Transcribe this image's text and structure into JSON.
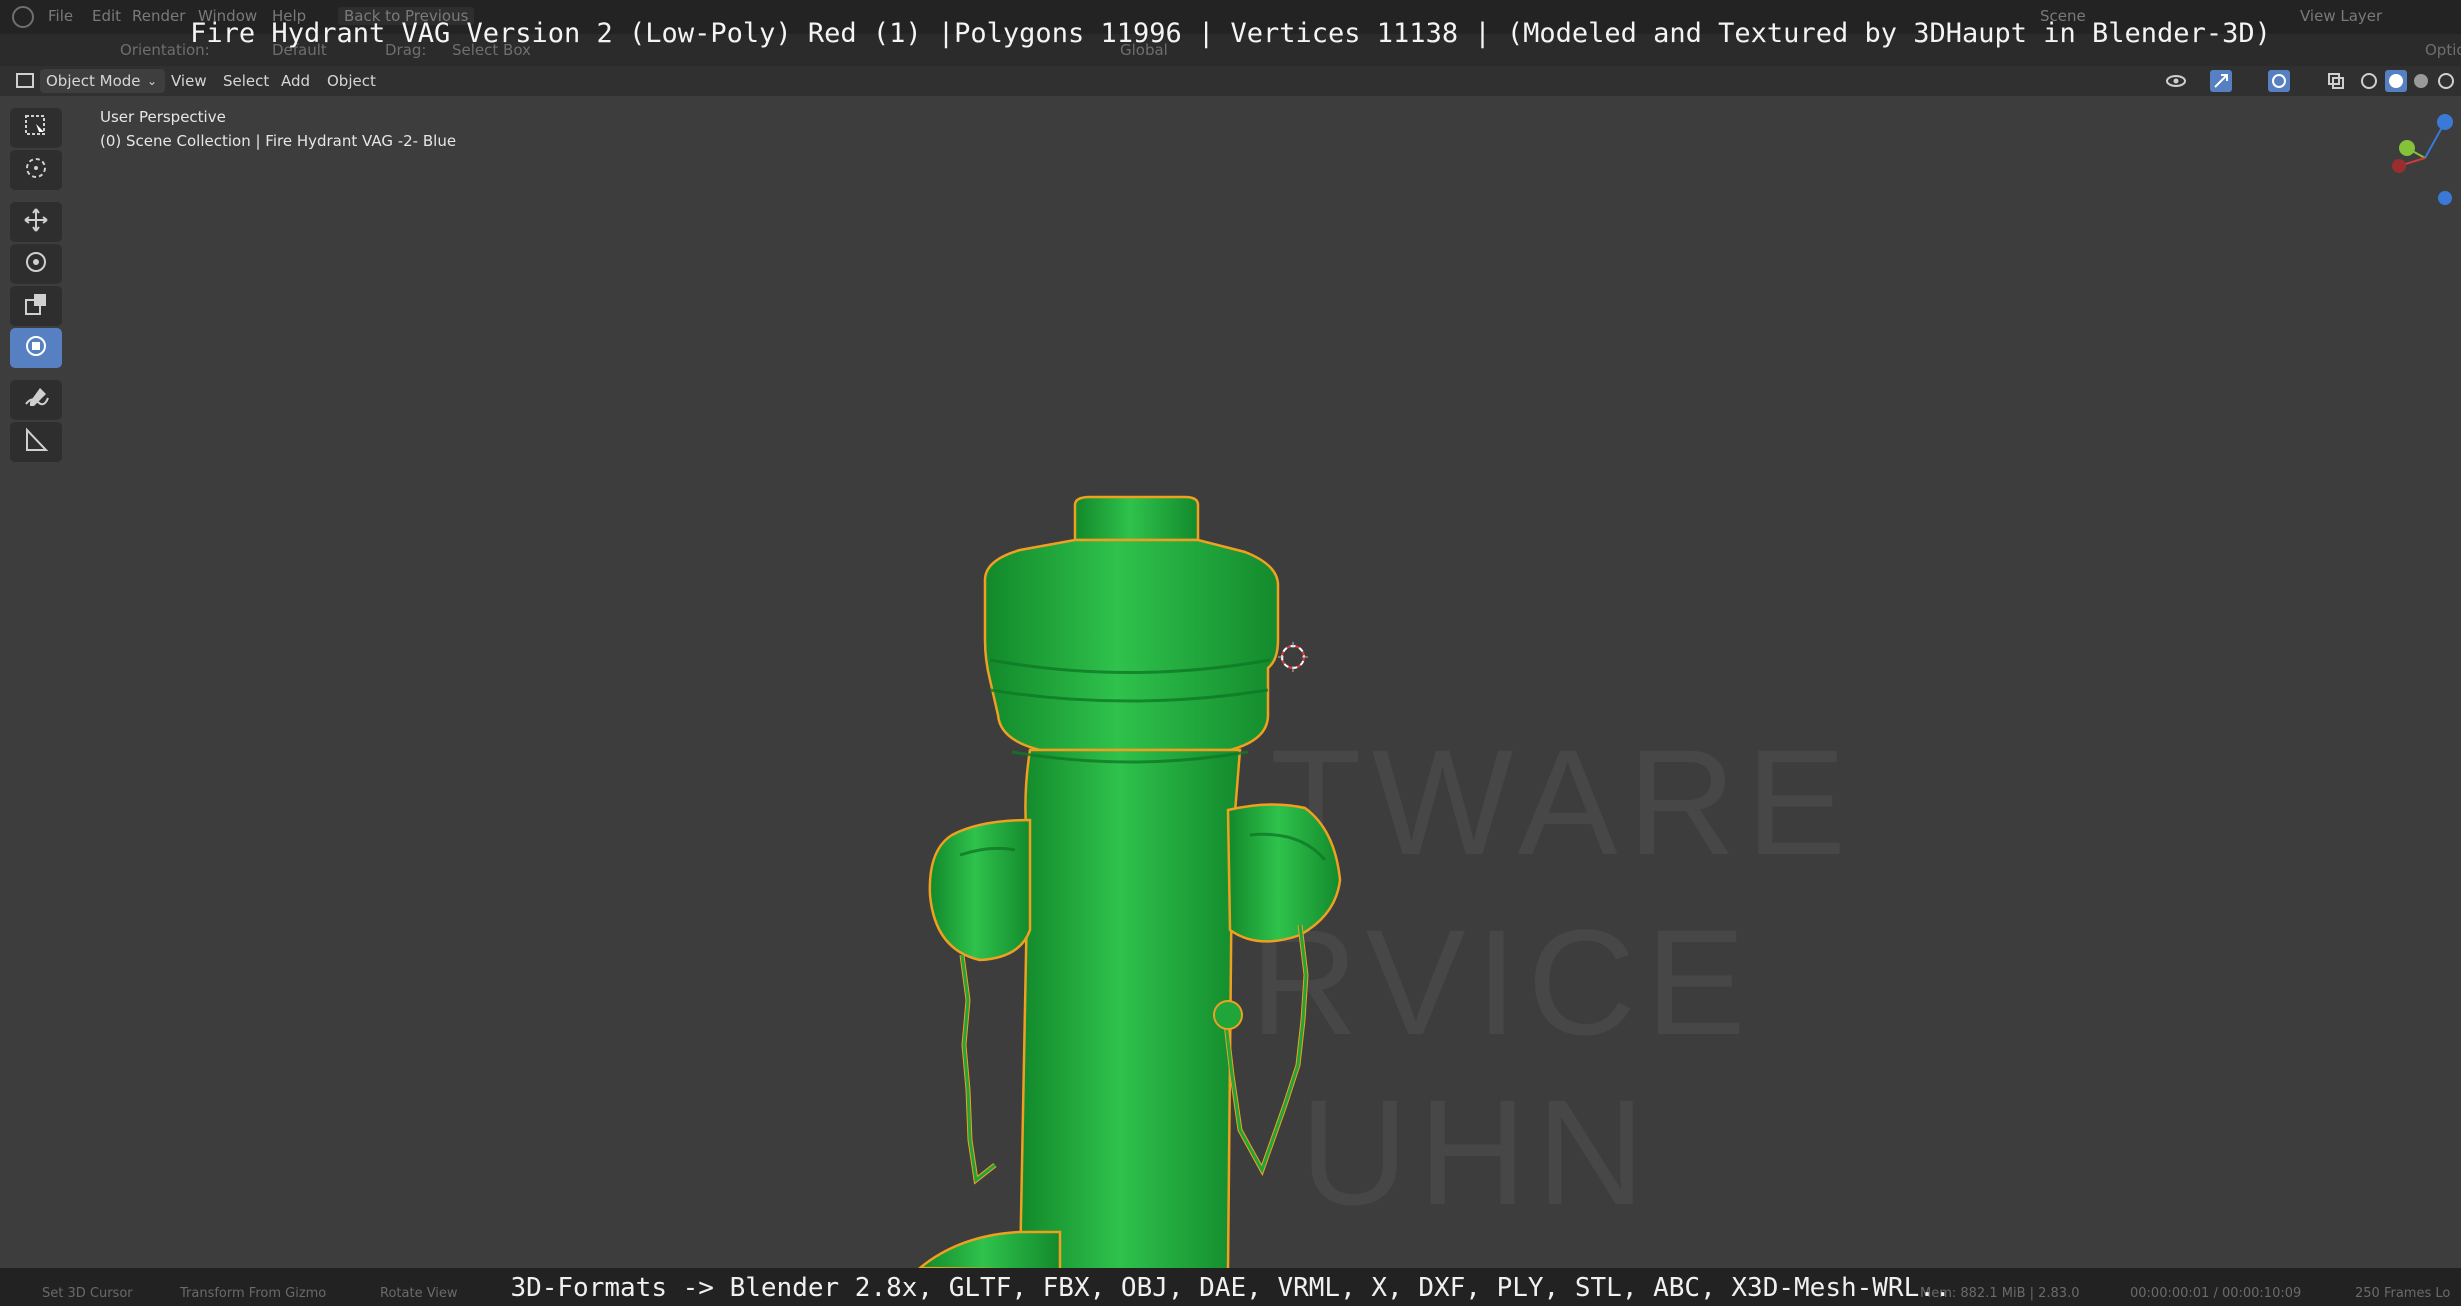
{
  "overlay": {
    "title": "Fire Hydrant VAG Version 2 (Low-Poly) Red (1) |Polygons 11996 | Vertices 11138 | (Modeled and Textured by 3DHaupt in Blender-3D)",
    "footer": "3D-Formats -> Blender 2.8x, GLTF, FBX, OBJ, DAE, VRML, X, DXF, PLY, STL, ABC, X3D-Mesh-WRL.."
  },
  "menubar": {
    "items": [
      "File",
      "Edit",
      "Render",
      "Window",
      "Help"
    ],
    "back_label": "Back to Previous",
    "scene_label": "Scene",
    "view_layer_label": "View Layer"
  },
  "tool_header": {
    "orientation_label": "Orientation:",
    "orientation_value": "Default",
    "drag_label": "Drag:",
    "drag_value": "Select Box",
    "transform_value": "Global",
    "options_label": "Optio"
  },
  "viewport_header": {
    "mode": "Object Mode",
    "menus": [
      "View",
      "Select",
      "Add",
      "Object"
    ]
  },
  "viewport": {
    "perspective": "User Perspective",
    "collection": "(0) Scene Collection | Fire Hydrant VAG -2- Blue",
    "watermark": [
      "TWARE",
      "RVICE",
      "UHN"
    ]
  },
  "statusbar": {
    "left_items": [
      "Set 3D Cursor",
      "Transform From Gizmo",
      "Rotate View"
    ],
    "mem": "Mem: 882.1 MiB | 2.83.0",
    "time": "00:00:00:01 / 00:00:10:09",
    "frames": "250 Frames Lo"
  },
  "colors": {
    "hydrant": "#1fa53a",
    "outline": "#f0a020",
    "active_tool": "#5680c2"
  }
}
